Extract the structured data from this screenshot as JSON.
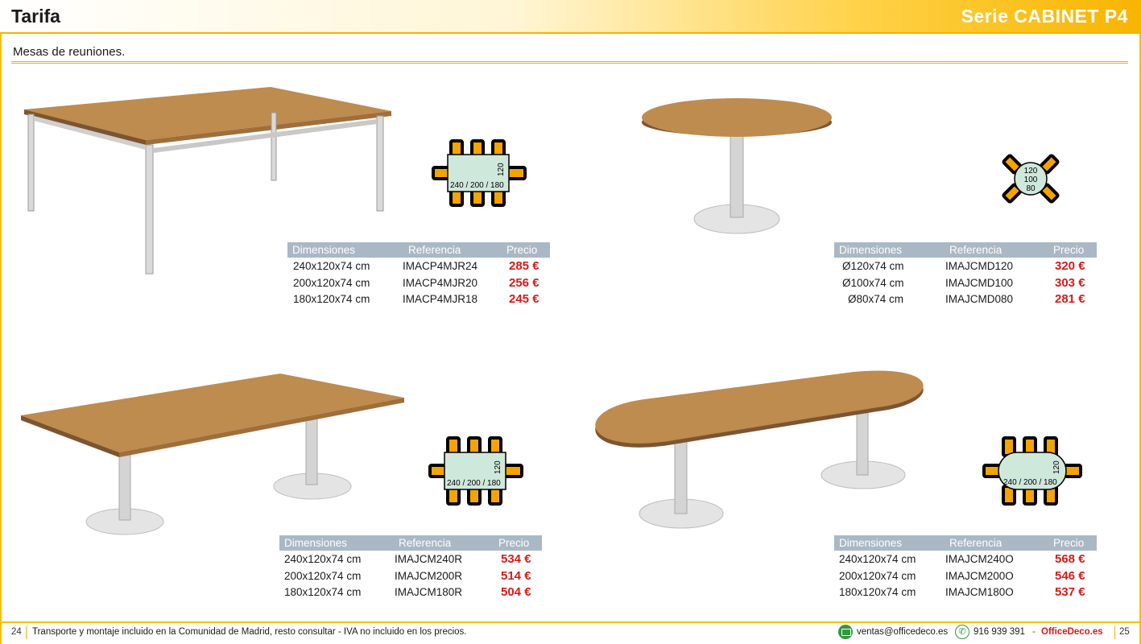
{
  "header": {
    "title": "Tarifa",
    "series": "Serie CABINET P4"
  },
  "subtitle": "Mesas de reuniones.",
  "table_headers": {
    "dimensions": "Dimensiones",
    "reference": "Referencia",
    "price": "Precio"
  },
  "products": [
    {
      "plan": {
        "width_label": "120",
        "length_label": "240 / 200 / 180"
      },
      "rows": [
        {
          "dim": "240x120x74 cm",
          "ref": "IMACP4MJR24",
          "price": "285 €"
        },
        {
          "dim": "200x120x74 cm",
          "ref": "IMACP4MJR20",
          "price": "256 €"
        },
        {
          "dim": "180x120x74 cm",
          "ref": "IMACP4MJR18",
          "price": "245 €"
        }
      ]
    },
    {
      "plan": {
        "diam_labels": [
          "120",
          "100",
          "80"
        ]
      },
      "rows": [
        {
          "dim": "Ø120x74 cm",
          "ref": "IMAJCMD120",
          "price": "320 €"
        },
        {
          "dim": "Ø100x74 cm",
          "ref": "IMAJCMD100",
          "price": "303 €"
        },
        {
          "dim": "Ø80x74 cm",
          "ref": "IMAJCMD080",
          "price": "281 €"
        }
      ]
    },
    {
      "plan": {
        "width_label": "120",
        "length_label": "240 / 200 / 180"
      },
      "rows": [
        {
          "dim": "240x120x74 cm",
          "ref": "IMAJCM240R",
          "price": "534 €"
        },
        {
          "dim": "200x120x74 cm",
          "ref": "IMAJCM200R",
          "price": "514 €"
        },
        {
          "dim": "180x120x74 cm",
          "ref": "IMAJCM180R",
          "price": "504 €"
        }
      ]
    },
    {
      "plan": {
        "width_label": "120",
        "length_label": "240 / 200 / 180"
      },
      "rows": [
        {
          "dim": "240x120x74 cm",
          "ref": "IMAJCM240O",
          "price": "568 €"
        },
        {
          "dim": "200x120x74 cm",
          "ref": "IMAJCM200O",
          "price": "546 €"
        },
        {
          "dim": "180x120x74 cm",
          "ref": "IMAJCM180O",
          "price": "537 €"
        }
      ]
    }
  ],
  "footer": {
    "page_left": "24",
    "note": "Transporte y montaje incluido en la Comunidad de Madrid, resto consultar - IVA no incluido en los precios.",
    "email": "ventas@officedeco.es",
    "phone": "916 939 391",
    "dash": "-",
    "brand": "OfficeDeco.es",
    "page_right": "25"
  },
  "colors": {
    "accent": "#f2b300",
    "price": "#d61a1a",
    "table_header": "#a9b8c4",
    "wood": "#b98a4c",
    "chair": "#f4a400",
    "plan_table": "#cfe8dc"
  }
}
